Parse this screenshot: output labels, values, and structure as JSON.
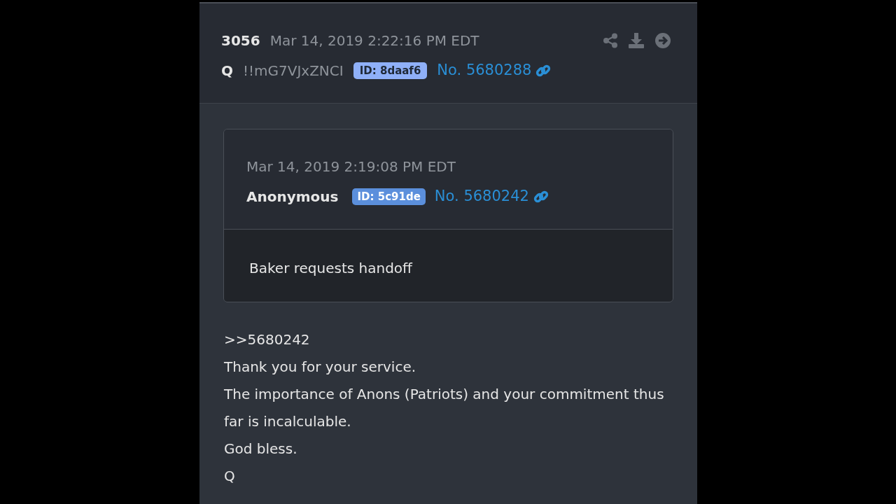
{
  "post": {
    "number": "3056",
    "date": "Mar 14, 2019 2:22:16 PM EDT",
    "author": "Q",
    "tripcode": "!!mG7VJxZNCI",
    "id_badge": {
      "text": "ID: 8daaf6",
      "color": "#8fb0f8"
    },
    "link": "No. 5680288"
  },
  "quoted": {
    "date": "Mar 14, 2019 2:19:08 PM EDT",
    "author": "Anonymous",
    "id_badge": {
      "text": "ID: 5c91de",
      "color": "#5b8fdc"
    },
    "link": "No. 5680242",
    "text": "Baker requests handoff"
  },
  "body": [
    ">>5680242",
    "Thank you for your service.",
    "The importance of Anons (Patriots) and your commitment thus far is incalculable.",
    "God bless.",
    "Q"
  ]
}
